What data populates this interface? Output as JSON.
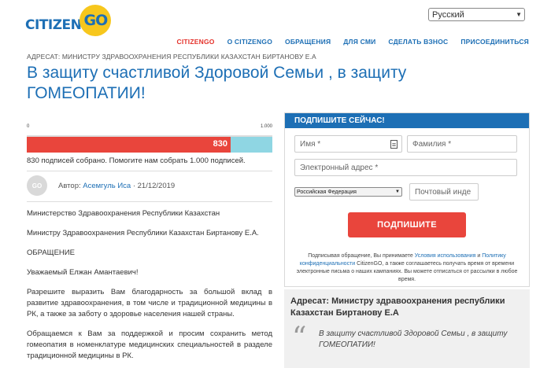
{
  "header": {
    "logo_left": "CITIZEN",
    "logo_right": "GO",
    "language": "Русский",
    "nav": [
      {
        "label": "CITIZENGO",
        "active": true
      },
      {
        "label": "О CITIZENGO",
        "active": false
      },
      {
        "label": "ОБРАЩЕНИЯ",
        "active": false
      },
      {
        "label": "ДЛЯ СМИ",
        "active": false
      },
      {
        "label": "СДЕЛАТЬ ВЗНОС",
        "active": false
      },
      {
        "label": "ПРИСОЕДИНИТЬСЯ",
        "active": false
      }
    ]
  },
  "petition": {
    "addressee": "АДРЕСАТ: МИНИСТРУ ЗДРАВООХРАНЕНИЯ РЕСПУБЛИКИ КАЗАХСТАН БИРТАНОВУ Е.А",
    "title": "В защиту счастливой Здоровой Семьи , в защиту ГОМЕОПАТИИ!",
    "progress": {
      "min_label": "0",
      "max_label": "1.000",
      "current_label": "830",
      "fraction": 0.83,
      "caption": "830 подписей собрано. Помогите нам собрать 1.000 подписей."
    },
    "author": {
      "avatar_text": "GO",
      "prefix": "Автор:",
      "name": "Асемгуль Иса",
      "date": "· 21/12/2019"
    },
    "body": [
      "Министерство Здравоохранения Республики Казахстан",
      "Министру Здравоохранения Республики Казахстан Биртанову Е.А.",
      "ОБРАЩЕНИЕ",
      "Уважаемый Елжан Амантаевич!",
      "Разрешите выразить Вам благодарность за большой вклад в развитие здравоохранения, в том числе и традиционной медицины в РК, а также за заботу о здоровье населения нашей страны.",
      "Обращаемся к Вам за поддержкой и просим сохранить метод гомеопатия в номенклатуре медицинских специальностей в разделе традиционной медицины в РК."
    ]
  },
  "sign_form": {
    "heading": "ПОДПИШИТЕ СЕЙЧАС!",
    "first_name_placeholder": "Имя *",
    "last_name_placeholder": "Фамилия *",
    "email_placeholder": "Электронный адрес *",
    "country": "Российская Федерация",
    "postal_placeholder": "Почтовый инде",
    "submit_label": "ПОДПИШИТЕ",
    "disclaimer_1": "Подписывая обращение, Вы принимаете ",
    "terms_link": "Условия использования",
    "disclaimer_2": " и ",
    "privacy_link": "Политику конфиденциальности",
    "disclaimer_3": " CitizenGO, а также соглашаетесь получать время от времени электронные письма о наших кампаниях. Вы можете отписаться от рассылки в любое время."
  },
  "quote": {
    "title": "Адресат: Министру здравоохранения республики Казахстан Биртанову Е.А",
    "text": "В защиту счастливой Здоровой Семьи , в защиту ГОМЕОПАТИИ!"
  },
  "colors": {
    "brand_blue": "#1d6fb5",
    "accent_red": "#e9453c",
    "logo_yellow": "#f7c71d",
    "progress_bg": "#8fd6e3"
  }
}
